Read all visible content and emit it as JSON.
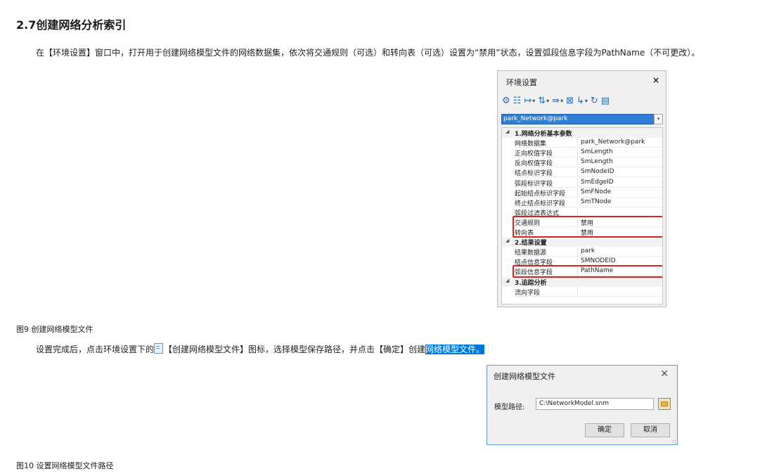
{
  "heading": "2.7创建网络分析索引",
  "para1": "在【环境设置】窗口中，打开用于创建网络模型文件的网络数据集，依次将交通规则（可选）和转向表（可选）设置为“禁用”状态，设置弧段信息字段为PathName（不可更改）。",
  "figure1": {
    "caption": "图9 创建网络模型文件",
    "panel": {
      "title": "环境设置",
      "close": "×",
      "toolbar": [
        "gear-icon",
        "layers-icon",
        "arrow-split-icon",
        "weight-icon",
        "turn-icon",
        "grid-icon",
        "node-icon",
        "refresh-icon",
        "create-model-icon"
      ],
      "dataset": "park_Network@park",
      "dropdown_glyph": "▾",
      "categories": [
        {
          "label": "1.网络分析基本参数",
          "rows": [
            {
              "name": "网络数据集",
              "value": "park_Network@park"
            },
            {
              "name": "正向权值字段",
              "value": "SmLength"
            },
            {
              "name": "反向权值字段",
              "value": "SmLength"
            },
            {
              "name": "结点标识字段",
              "value": "SmNodeID"
            },
            {
              "name": "弧段标识字段",
              "value": "SmEdgeID"
            },
            {
              "name": "起始结点标识字段",
              "value": "SmFNode"
            },
            {
              "name": "终止结点标识字段",
              "value": "SmTNode"
            },
            {
              "name": "弧段过滤表达式",
              "value": ""
            },
            {
              "name": "交通规则",
              "value": "禁用"
            },
            {
              "name": "转向表",
              "value": "禁用"
            }
          ]
        },
        {
          "label": "2.结果设置",
          "rows": [
            {
              "name": "结果数据源",
              "value": "park"
            },
            {
              "name": "结点信息字段",
              "value": "SMNODEID"
            },
            {
              "name": "弧段信息字段",
              "value": "PathName"
            }
          ]
        },
        {
          "label": "3.追踪分析",
          "rows": [
            {
              "name": "流向字段",
              "value": ""
            }
          ]
        }
      ]
    }
  },
  "para2": {
    "before": "设置完成后，点击环境设置下的",
    "after": "【创建网络模型文件】图标，选择模型保存路径，并点击【确定】创建",
    "highlight": "网络模型文件。"
  },
  "figure2": {
    "caption": "图10 设置网络模型文件路径",
    "dialog": {
      "title": "创建网络模型文件",
      "close": "✕",
      "path_label": "模型路径:",
      "path_value": "C:\\NetworkModel.snm",
      "ok": "确定",
      "cancel": "取消"
    }
  }
}
